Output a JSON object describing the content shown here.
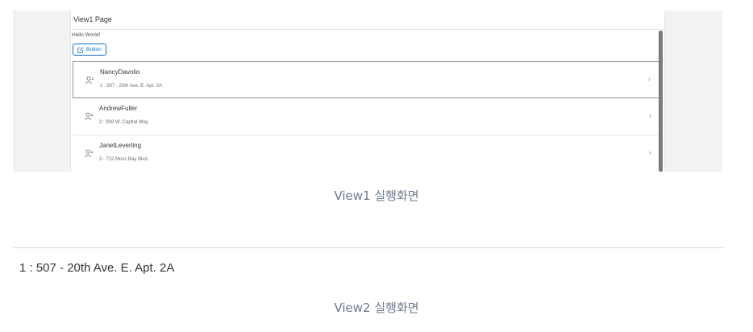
{
  "view1": {
    "page_title": "View1 Page",
    "hello_text": "Hello World!",
    "button_label": "Button",
    "list": [
      {
        "name": "NancyDavolio",
        "address": "1 : 507 - 20th Ave. E. Apt. 2A"
      },
      {
        "name": "AndrewFuller",
        "address": "2 : 908 W. Capital Way"
      },
      {
        "name": "JanetLeverling",
        "address": "3 : 722 Moss Bay Blvd."
      }
    ]
  },
  "caption1": "View1 실행화면",
  "view2": {
    "text": "1 : 507 - 20th Ave. E. Apt. 2A"
  },
  "caption2": "View2 실행화면",
  "colors": {
    "accent": "#0a6ed1",
    "caption": "#6b7c8c"
  },
  "icons": {
    "button": "edit-icon",
    "list_item": "employee-icon",
    "navigation": "chevron-right-icon"
  }
}
